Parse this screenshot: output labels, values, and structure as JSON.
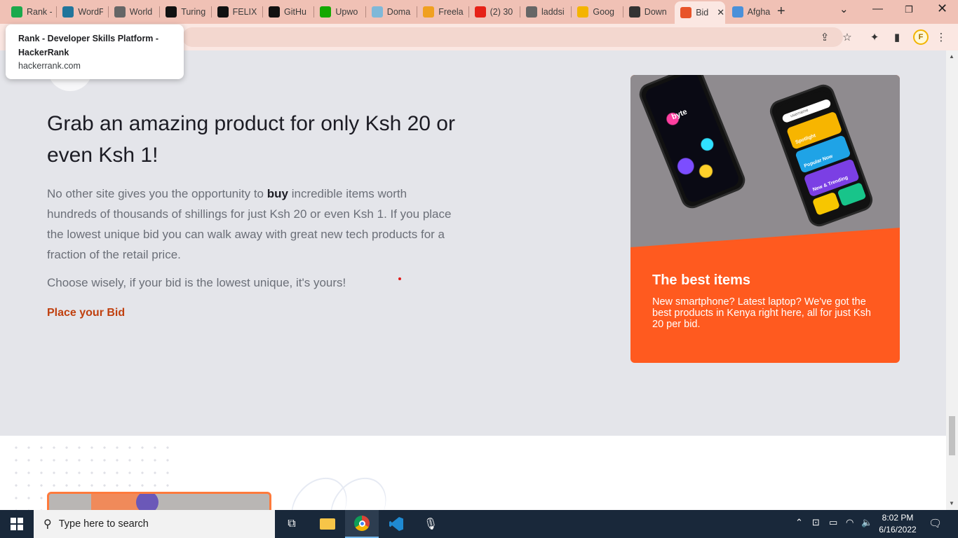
{
  "browser": {
    "tabs": [
      {
        "title": "Rank -",
        "favicon": "hackerrank-icon",
        "color": "#1ba94c"
      },
      {
        "title": "WordP",
        "favicon": "wordpress-icon",
        "color": "#21759b"
      },
      {
        "title": "World",
        "favicon": "globe-icon",
        "color": "#666666"
      },
      {
        "title": "Turing",
        "favicon": "turing-icon",
        "color": "#111111"
      },
      {
        "title": "FELIX",
        "favicon": "turing-icon",
        "color": "#111111"
      },
      {
        "title": "GitHu",
        "favicon": "github-icon",
        "color": "#111111"
      },
      {
        "title": "Upwo",
        "favicon": "upwork-icon",
        "color": "#14a800"
      },
      {
        "title": "Doma",
        "favicon": "domain-icon",
        "color": "#7fb8d8"
      },
      {
        "title": "Freela",
        "favicon": "freelancer-icon",
        "color": "#f0a020"
      },
      {
        "title": "(2) 30",
        "favicon": "youtube-icon",
        "color": "#e62117"
      },
      {
        "title": "laddsi",
        "favicon": "globe-icon",
        "color": "#666666"
      },
      {
        "title": "Goog",
        "favicon": "bulb-icon",
        "color": "#f4b400"
      },
      {
        "title": "Down",
        "favicon": "download-icon",
        "color": "#333333"
      },
      {
        "title": "Bid",
        "favicon": "bid-icon",
        "color": "#e8542a"
      },
      {
        "title": "Afgha",
        "favicon": "map-icon",
        "color": "#4a90d9"
      }
    ],
    "active_tab_index": 13,
    "new_tab_label": "+",
    "tooltip": {
      "title": "Rank - Developer Skills Platform - HackerRank",
      "url": "hackerrank.com"
    },
    "profile_initial": "F"
  },
  "page": {
    "headline": "Grab an amazing product for only Ksh 20 or even Ksh 1!",
    "paragraph_before": "No other site gives you the opportunity to ",
    "paragraph_bold": "buy",
    "paragraph_after": " incredible items worth hundreds of thousands of shillings for just Ksh 20 or even Ksh 1. If you place the lowest unique bid you can walk away with great new tech products for a fraction of the retail price.",
    "paragraph2": "Choose wisely, if your bid is the lowest unique, it's yours!",
    "cta": "Place your Bid",
    "card": {
      "title": "The best items",
      "text": "New smartphone? Latest laptop? We've got the best products in Kenya right here, all for just Ksh 20 per bid.",
      "photo_texts": {
        "app_logo": "byte",
        "search_placeholder": "username",
        "spotlight": "Spotlight",
        "popular": "Popular Now",
        "trending": "New & Trending"
      }
    },
    "colors": {
      "accent": "#ff5a1f",
      "cta": "#c0400f"
    }
  },
  "taskbar": {
    "search_placeholder": "Type here to search",
    "time": "8:02 PM",
    "date": "6/16/2022"
  }
}
